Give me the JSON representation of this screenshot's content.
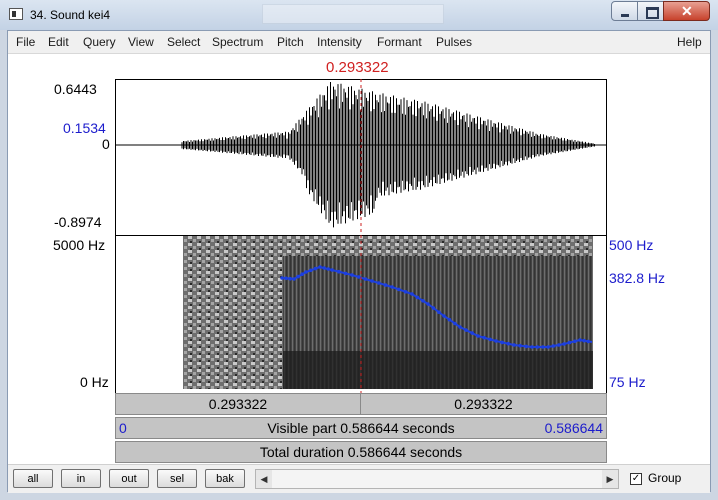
{
  "window": {
    "title": "34. Sound kei4"
  },
  "menu": [
    "File",
    "Edit",
    "Query",
    "View",
    "Select",
    "Spectrum",
    "Pitch",
    "Intensity",
    "Formant",
    "Pulses"
  ],
  "help": "Help",
  "cursor": {
    "time": "0.293322",
    "fraction": 0.5
  },
  "waveform": {
    "ymax": "0.6443",
    "cursor_value": "0.1534",
    "zero": "0",
    "ymin": "-0.8974"
  },
  "spectrogram": {
    "freq_top": "5000 Hz",
    "freq_bottom": "0 Hz"
  },
  "pitch": {
    "top": "500 Hz",
    "cursor_value": "382.8 Hz",
    "bottom": "75 Hz"
  },
  "time_bars": {
    "left_segment": "0.293322",
    "right_segment": "0.293322",
    "visible_start": "0",
    "visible_label": "Visible part 0.586644 seconds",
    "visible_end": "0.586644",
    "total_label": "Total duration 0.586644 seconds"
  },
  "buttons": [
    "all",
    "in",
    "out",
    "sel",
    "bak"
  ],
  "group": {
    "label": "Group",
    "checked": true
  },
  "colors": {
    "pitch": "#1c3fe0",
    "cursor": "#cc2020",
    "axis_blue": "#1c1ccc"
  }
}
